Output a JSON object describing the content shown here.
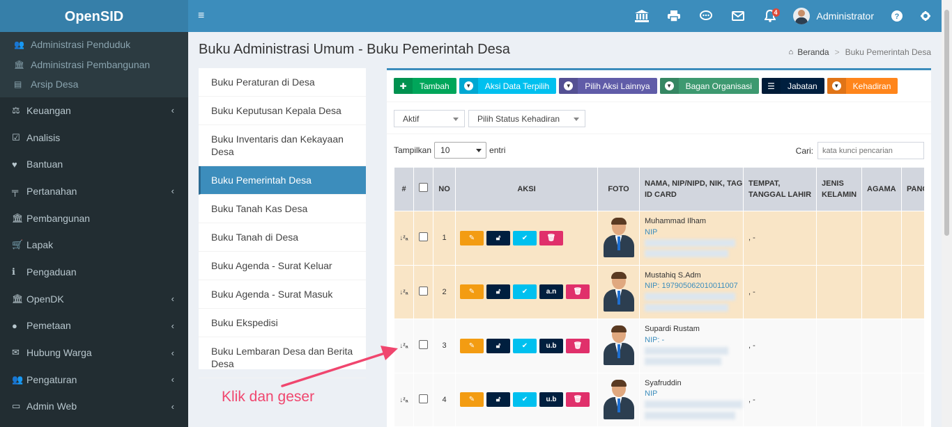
{
  "app": {
    "logo": "OpenSID"
  },
  "header": {
    "notification_count": "4",
    "user_name": "Administrator"
  },
  "sidebar": {
    "sub_items": [
      {
        "label": "Administrasi Penduduk",
        "icon": "users-icon"
      },
      {
        "label": "Administrasi Pembangunan",
        "icon": "bank-icon"
      },
      {
        "label": "Arsip Desa",
        "icon": "archive-icon"
      }
    ],
    "items": [
      {
        "label": "Keuangan",
        "icon": "balance-scale-icon",
        "chevron": true
      },
      {
        "label": "Analisis",
        "icon": "check-square-icon",
        "chevron": false
      },
      {
        "label": "Bantuan",
        "icon": "heart-icon",
        "chevron": false
      },
      {
        "label": "Pertanahan",
        "icon": "map-signs-icon",
        "chevron": true
      },
      {
        "label": "Pembangunan",
        "icon": "bank-icon",
        "chevron": false
      },
      {
        "label": "Lapak",
        "icon": "cart-icon",
        "chevron": false
      },
      {
        "label": "Pengaduan",
        "icon": "info-icon",
        "chevron": false
      },
      {
        "label": "OpenDK",
        "icon": "bank-icon",
        "chevron": true
      },
      {
        "label": "Pemetaan",
        "icon": "globe-icon",
        "chevron": true
      },
      {
        "label": "Hubung Warga",
        "icon": "envelope-icon",
        "chevron": true
      },
      {
        "label": "Pengaturan",
        "icon": "users-icon",
        "chevron": true
      },
      {
        "label": "Admin Web",
        "icon": "desktop-icon",
        "chevron": true
      }
    ]
  },
  "page": {
    "title": "Buku Administrasi Umum - Buku Pemerintah Desa",
    "breadcrumb_home": "Beranda",
    "breadcrumb_current": "Buku Pemerintah Desa"
  },
  "left_menu": [
    {
      "label": "Buku Peraturan di Desa",
      "active": false
    },
    {
      "label": "Buku Keputusan Kepala Desa",
      "active": false
    },
    {
      "label": "Buku Inventaris dan Kekayaan Desa",
      "active": false
    },
    {
      "label": "Buku Pemerintah Desa",
      "active": true
    },
    {
      "label": "Buku Tanah Kas Desa",
      "active": false
    },
    {
      "label": "Buku Tanah di Desa",
      "active": false
    },
    {
      "label": "Buku Agenda - Surat Keluar",
      "active": false
    },
    {
      "label": "Buku Agenda - Surat Masuk",
      "active": false
    },
    {
      "label": "Buku Ekspedisi",
      "active": false
    },
    {
      "label": "Buku Lembaran Desa dan Berita Desa",
      "active": false
    }
  ],
  "toolbar": {
    "tambah": "Tambah",
    "aksi_data": "Aksi Data Terpilih",
    "pilih_aksi": "Pilih Aksi Lainnya",
    "bagan": "Bagan Organisasi",
    "jabatan": "Jabatan",
    "kehadiran": "Kehadiran"
  },
  "filters": {
    "status": "Aktif",
    "kehadiran": "Pilih Status Kehadiran"
  },
  "table_controls": {
    "show_label": "Tampilkan",
    "page_size": "10",
    "entries_label": "entri",
    "search_label": "Cari:",
    "search_placeholder": "kata kunci pencarian"
  },
  "table": {
    "headers": {
      "hash": "#",
      "no": "NO",
      "aksi": "AKSI",
      "foto": "FOTO",
      "nama": "NAMA, NIP/NIPD, NIK, TAG ID CARD",
      "ttl": "TEMPAT, TANGGAL LAHIR",
      "jk": "JENIS KELAMIN",
      "agama": "AGAMA",
      "pangkat": "PANG GOLO"
    },
    "rows": [
      {
        "no": "1",
        "name": "Muhammad Ilham",
        "nip": "NIP",
        "ttl": ", -",
        "extra_btn": "",
        "highlight": true
      },
      {
        "no": "2",
        "name": "Mustahiq S.Adm",
        "nip": "NIP: 197905062010011007",
        "ttl": ", -",
        "extra_btn": "a.n",
        "highlight": true
      },
      {
        "no": "3",
        "name": "Supardi Rustam",
        "nip": "NIP: -",
        "ttl": ", -",
        "extra_btn": "u.b",
        "highlight": false
      },
      {
        "no": "4",
        "name": "Syafruddin",
        "nip": "NIP",
        "ttl": ", -",
        "extra_btn": "u.b",
        "highlight": false
      }
    ]
  },
  "annotation": {
    "text": "Klik dan geser",
    "color": "#f0466e"
  },
  "colors": {
    "header": "#3c8dbc",
    "sidebar": "#222d32",
    "highlight_row": "#f9e5c6"
  }
}
